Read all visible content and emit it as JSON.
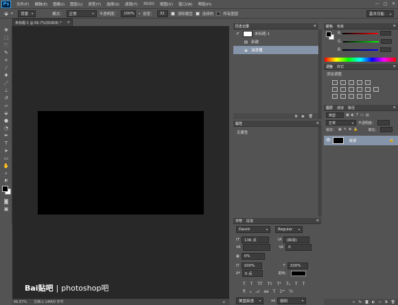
{
  "app": {
    "logo": "Ps"
  },
  "menu": [
    "文件(F)",
    "编辑(E)",
    "图像(I)",
    "图层(L)",
    "类型(Y)",
    "选择(S)",
    "滤镜(T)",
    "3D(D)",
    "视图(V)",
    "窗口(W)",
    "帮助(H)"
  ],
  "window_controls": {
    "minimize": "—",
    "maximize": "□",
    "close": "✕"
  },
  "options": {
    "brush_preset": "背景",
    "size": "1",
    "mode_label": "模式：",
    "mode_value": "正常",
    "opacity_label": "不透明度：",
    "opacity_value": "100%",
    "tolerance_label": "容差：",
    "tolerance_value": "32",
    "antialias_label": "消除锯齿",
    "contiguous_label": "连续的",
    "all_layers_label": "所有图层",
    "workspace": "基本功能"
  },
  "document": {
    "tab_title": "未标题-1 @ 66.7%(RGB/8) *",
    "close": "×"
  },
  "status": {
    "zoom": "66.67%",
    "doc_info": "文档:1.14M/0 字节"
  },
  "watermark": {
    "logo": "Bai贴吧",
    "sep": "|",
    "text": "photoshop吧"
  },
  "history": {
    "tab": "历史记录",
    "snapshot": "未标题-1",
    "items": [
      {
        "label": "新建",
        "selected": false
      },
      {
        "label": "油漆桶",
        "selected": true
      }
    ]
  },
  "properties": {
    "tab": "属性",
    "empty": "无属性"
  },
  "character": {
    "tabs": [
      "字符",
      "段落"
    ],
    "font": "David",
    "style": "Regular",
    "size": "136 点",
    "leading": "(自动)",
    "tracking": "0",
    "kerning_pct": "0%",
    "vscale": "100%",
    "hscale": "100%",
    "baseline": "0 点",
    "color_label": "颜色：",
    "language": "美国英语",
    "antialias": "锐利",
    "aa_label": "aa"
  },
  "color": {
    "tabs": [
      "颜色",
      "色板"
    ],
    "channels": [
      "R",
      "G",
      "B"
    ],
    "values": [
      "",
      "",
      ""
    ]
  },
  "adjustments": {
    "tabs": [
      "调整",
      "样式"
    ],
    "add_label": "添加调整"
  },
  "layers": {
    "tabs": [
      "图层",
      "通道",
      "路径"
    ],
    "kind_label": "类型",
    "blend": "正常",
    "opacity_label": "不透明度：",
    "opacity": "",
    "lock_label": "锁定：",
    "fill_label": "填充：",
    "items": [
      {
        "name": "背景",
        "visible": true,
        "locked": true
      }
    ]
  },
  "colors_ui": {
    "accent_selected": "#8594a8",
    "canvas": "#000000",
    "workspace_bg": "#282828",
    "panel": "#535353"
  }
}
